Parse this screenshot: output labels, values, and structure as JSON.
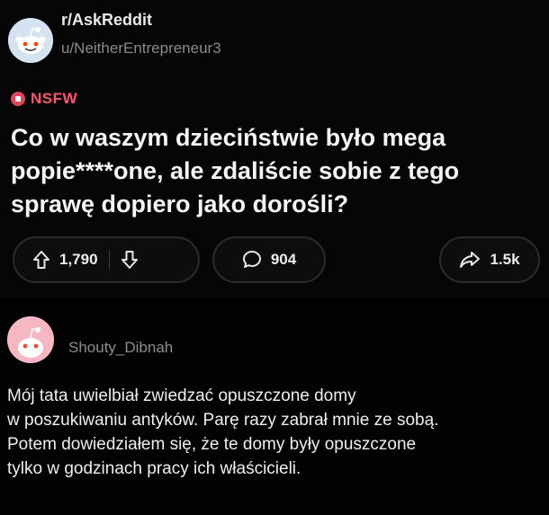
{
  "post": {
    "subreddit": "r/AskReddit",
    "author": "u/NeitherEntrepreneur3",
    "nsfw_label": "NSFW",
    "title": "Co w waszym dzieciństwie było mega popie****one, ale zdaliście sobie z tego sprawę dopiero jako dorośli?",
    "upvotes": "1,790",
    "comments": "904",
    "shares": "1.5k",
    "icons": [
      "reddit-snoo-avatar-icon",
      "nsfw-icon",
      "upvote-arrow-icon",
      "downvote-arrow-icon",
      "comment-bubble-icon",
      "share-arrow-icon"
    ]
  },
  "comment": {
    "author": "Shouty_Dibnah",
    "lines": [
      "Mój tata uwielbiał zwiedzać opuszczone domy",
      "w poszukiwaniu antyków. Parę razy zabrał mnie ze sobą.",
      "Potem dowiedziałem się, że te domy były opuszczone",
      "tylko w godzinach pracy ich właścicieli."
    ]
  },
  "colors": {
    "nsfw": "#ff5573",
    "background": "#000000",
    "muted_text": "#8b8b8b"
  }
}
